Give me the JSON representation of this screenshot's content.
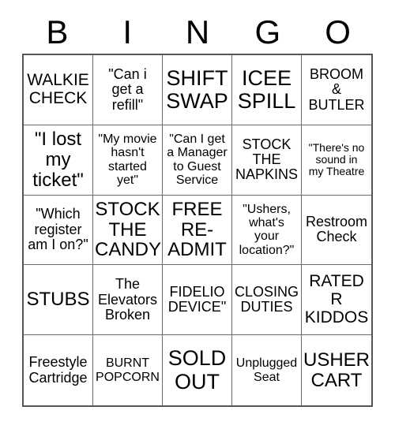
{
  "card": {
    "header_letters": [
      "B",
      "I",
      "N",
      "G",
      "O"
    ],
    "columns": 5,
    "rows": 5,
    "border_color": "#555555",
    "grid_line_color": "#6b6b6b",
    "background_color": "#ffffff",
    "text_color": "#000000",
    "cells": [
      {
        "text": "WALKIE\nCHECK",
        "size": "fs-l"
      },
      {
        "text": "\"Can i\nget a\nrefill\"",
        "size": "fs-m"
      },
      {
        "text": "SHIFT\nSWAP",
        "size": "fs-xxl"
      },
      {
        "text": "ICEE\nSPILL",
        "size": "fs-xxl"
      },
      {
        "text": "BROOM\n&\nBUTLER",
        "size": "fs-m"
      },
      {
        "text": "\"I lost\nmy\nticket\"",
        "size": "fs-xl"
      },
      {
        "text": "\"My movie\nhasn't\nstarted\nyet\"",
        "size": "fs-s"
      },
      {
        "text": "\"Can I get\na Manager\nto Guest\nService",
        "size": "fs-s"
      },
      {
        "text": "STOCK\nTHE\nNAPKINS",
        "size": "fs-m"
      },
      {
        "text": "\"There's no\nsound in\nmy Theatre",
        "size": "fs-xs"
      },
      {
        "text": "\"Which\nregister\nam I on?\"",
        "size": "fs-m"
      },
      {
        "text": "STOCK\nTHE\nCANDY",
        "size": "fs-xl"
      },
      {
        "text": "FREE\nRE-\nADMIT",
        "size": "fs-xl"
      },
      {
        "text": "\"Ushers,\nwhat's\nyour\nlocation?\"",
        "size": "fs-s"
      },
      {
        "text": "Restroom\nCheck",
        "size": "fs-m"
      },
      {
        "text": "STUBS",
        "size": "fs-xl"
      },
      {
        "text": "The\nElevators\nBroken",
        "size": "fs-m"
      },
      {
        "text": "FIDELIO\nDEVICE\"",
        "size": "fs-m"
      },
      {
        "text": "CLOSING\nDUTIES",
        "size": "fs-m"
      },
      {
        "text": "RATED\nR\nKIDDOS",
        "size": "fs-l"
      },
      {
        "text": "Freestyle\nCartridge",
        "size": "fs-m"
      },
      {
        "text": "BURNT\nPOPCORN",
        "size": "fs-s"
      },
      {
        "text": "SOLD\nOUT",
        "size": "fs-xxl"
      },
      {
        "text": "Unplugged\nSeat",
        "size": "fs-s"
      },
      {
        "text": "USHER\nCART",
        "size": "fs-xl"
      }
    ]
  }
}
